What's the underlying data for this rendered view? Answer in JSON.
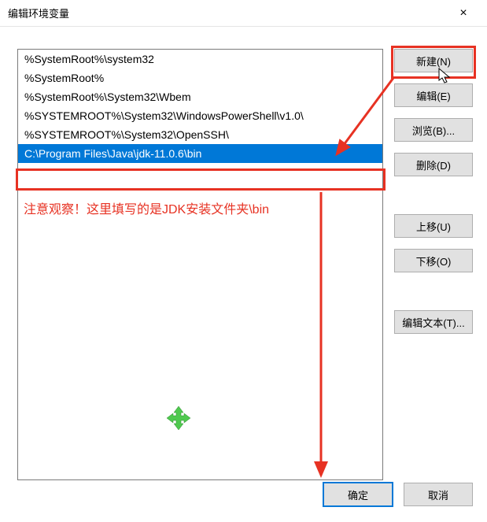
{
  "window": {
    "title": "编辑环境变量",
    "close_label": "×"
  },
  "list": {
    "items": [
      "%SystemRoot%\\system32",
      "%SystemRoot%",
      "%SystemRoot%\\System32\\Wbem",
      "%SYSTEMROOT%\\System32\\WindowsPowerShell\\v1.0\\",
      "%SYSTEMROOT%\\System32\\OpenSSH\\",
      "C:\\Program Files\\Java\\jdk-11.0.6\\bin"
    ],
    "selected_index": 5
  },
  "buttons": {
    "new": "新建(N)",
    "edit": "编辑(E)",
    "browse": "浏览(B)...",
    "delete": "删除(D)",
    "moveup": "上移(U)",
    "movedown": "下移(O)",
    "edittext": "编辑文本(T)...",
    "ok": "确定",
    "cancel": "取消"
  },
  "annotations": {
    "text": "注意观察！这里填写的是JDK安装文件夹\\bin",
    "highlight_color": "#e73223"
  }
}
